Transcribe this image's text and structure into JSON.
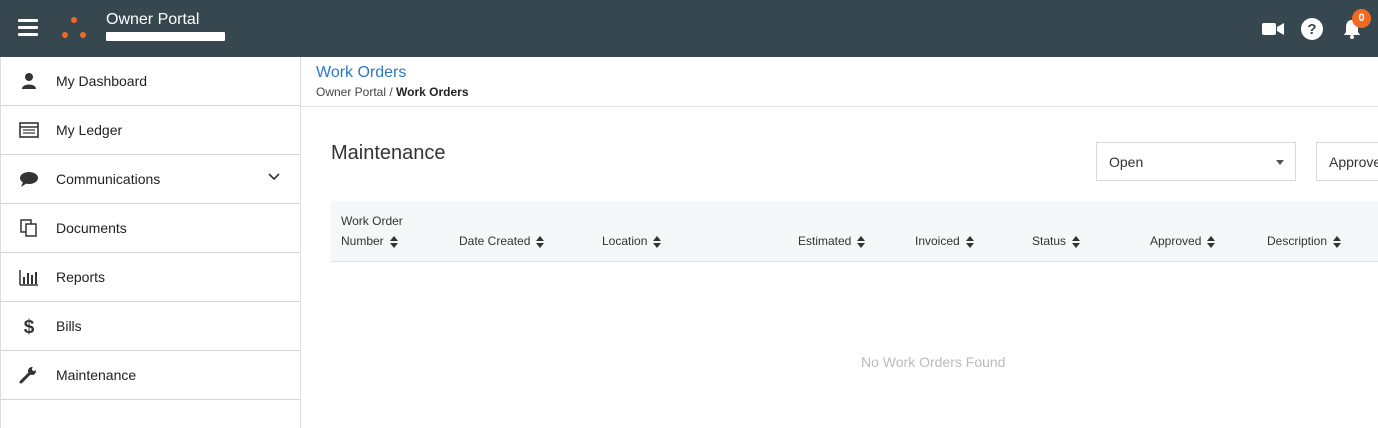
{
  "header": {
    "title": "Owner Portal",
    "notification_count": "0",
    "icons": [
      "menu-icon",
      "video-icon",
      "help-icon",
      "bell-icon"
    ],
    "colors": {
      "topbar": "#37474f",
      "accent": "#f26a21"
    }
  },
  "sidebar": {
    "items": [
      {
        "label": "My Dashboard",
        "icon": "user-icon"
      },
      {
        "label": "My Ledger",
        "icon": "ledger-icon"
      },
      {
        "label": "Communications",
        "icon": "chat-icon"
      },
      {
        "label": "Documents",
        "icon": "documents-icon"
      },
      {
        "label": "Reports",
        "icon": "reports-icon"
      },
      {
        "label": "Bills",
        "icon": "dollar-icon"
      },
      {
        "label": "Maintenance",
        "icon": "wrench-icon"
      }
    ]
  },
  "page": {
    "title": "Work Orders",
    "breadcrumb": {
      "root": "Owner Portal",
      "separator": " / ",
      "current": "Work Orders"
    }
  },
  "main": {
    "section_title": "Maintenance",
    "status_filter": "Open",
    "approval_filter": "Approve",
    "columns": [
      "Work Order",
      "Number",
      "Date Created",
      "Location",
      "Estimated",
      "Invoiced",
      "Status",
      "Approved",
      "Description"
    ],
    "empty_message": "No Work Orders Found"
  }
}
